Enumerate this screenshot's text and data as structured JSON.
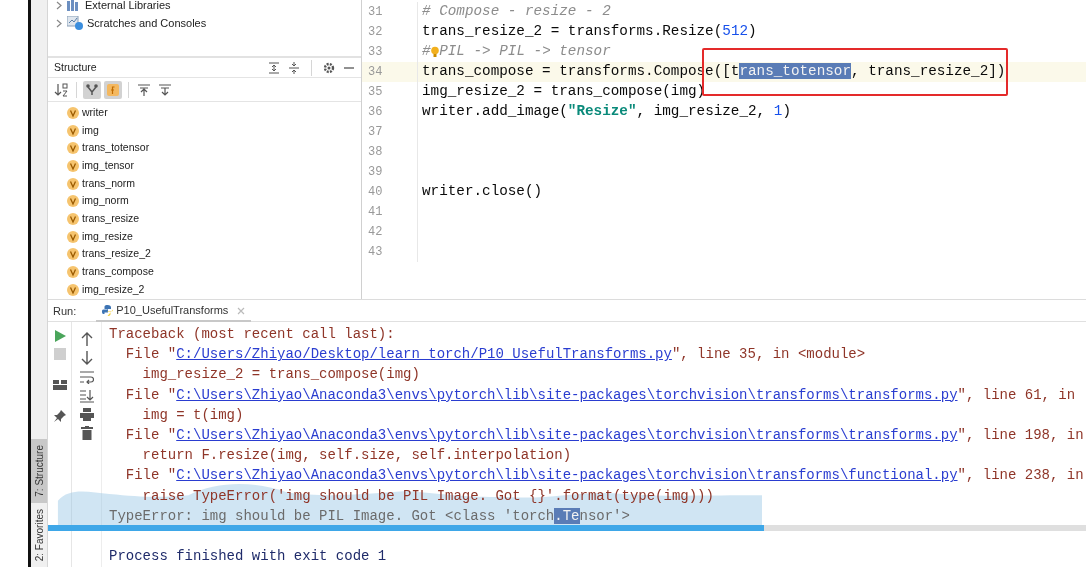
{
  "project_tree": [
    {
      "label": "External Libraries",
      "kind": "libraries"
    },
    {
      "label": "Scratches and Consoles",
      "kind": "scratches"
    }
  ],
  "structure": {
    "title": "Structure",
    "toolbar": [
      {
        "kind": "sort",
        "selected": false
      },
      {
        "kind": "inherited",
        "selected": true
      },
      {
        "kind": "fields",
        "selected": true
      },
      {
        "kind": "up",
        "selected": false
      },
      {
        "kind": "down",
        "selected": false
      }
    ],
    "items": [
      {
        "name": "writer"
      },
      {
        "name": "img"
      },
      {
        "name": "trans_totensor"
      },
      {
        "name": "img_tensor"
      },
      {
        "name": "trans_norm"
      },
      {
        "name": "img_norm"
      },
      {
        "name": "trans_resize"
      },
      {
        "name": "img_resize"
      },
      {
        "name": "trans_resize_2"
      },
      {
        "name": "trans_compose"
      },
      {
        "name": "img_resize_2"
      }
    ]
  },
  "editor": {
    "lines": [
      {
        "number": "31",
        "current": false,
        "segments": [
          {
            "text": "# Compose - resize - 2",
            "kind": "comment"
          }
        ]
      },
      {
        "number": "32",
        "current": false,
        "segments": [
          {
            "text": "trans_resize_2 = transforms.Resize(",
            "kind": "plain"
          },
          {
            "text": "512",
            "kind": "number"
          },
          {
            "text": ")",
            "kind": "plain"
          }
        ]
      },
      {
        "number": "33",
        "current": false,
        "segments": [
          {
            "text": "#",
            "kind": "comment"
          },
          {
            "kind": "bulb"
          },
          {
            "text": "PIL -> PIL -> tensor",
            "kind": "comment"
          }
        ]
      },
      {
        "number": "34",
        "current": true,
        "segments": [
          {
            "text": "trans_compose = transforms.Compose([t",
            "kind": "plain"
          },
          {
            "text": "rans_totensor",
            "kind": "selected"
          },
          {
            "text": ", trans_resize_2])",
            "kind": "plain"
          }
        ]
      },
      {
        "number": "35",
        "current": false,
        "segments": [
          {
            "text": "img_resize_2 = trans_compose(img)",
            "kind": "plain"
          }
        ]
      },
      {
        "number": "36",
        "current": false,
        "segments": [
          {
            "text": "writer.add_image(",
            "kind": "plain"
          },
          {
            "text": "\"Resize\"",
            "kind": "string"
          },
          {
            "text": ", img_resize_2, ",
            "kind": "plain"
          },
          {
            "text": "1",
            "kind": "number"
          },
          {
            "text": ")",
            "kind": "plain"
          }
        ]
      },
      {
        "number": "37",
        "current": false
      },
      {
        "number": "38",
        "current": false
      },
      {
        "number": "39",
        "current": false
      },
      {
        "number": "40",
        "current": false,
        "segments": [
          {
            "text": "writer.close()",
            "kind": "plain"
          }
        ]
      },
      {
        "number": "41",
        "current": false
      },
      {
        "number": "42",
        "current": false
      },
      {
        "number": "43",
        "current": false
      }
    ]
  },
  "run": {
    "label": "Run:",
    "tab": "P10_UsefulTransforms",
    "console": [
      {
        "segments": [
          {
            "text": "Traceback (most recent call last):",
            "kind": "err"
          }
        ]
      },
      {
        "segments": [
          {
            "text": "  File \"",
            "kind": "err"
          },
          {
            "text": "C:/Users/Zhiyao/Desktop/learn_torch/P10_UsefulTransforms.py",
            "kind": "link"
          },
          {
            "text": "\", line 35, in <module>",
            "kind": "err"
          }
        ]
      },
      {
        "segments": [
          {
            "text": "    img_resize_2 = trans_compose(img)",
            "kind": "err"
          }
        ]
      },
      {
        "segments": [
          {
            "text": "  File \"",
            "kind": "err"
          },
          {
            "text": "C:\\Users\\Zhiyao\\Anaconda3\\envs\\pytorch\\lib\\site-packages\\torchvision\\transforms\\transforms.py",
            "kind": "link"
          },
          {
            "text": "\", line 61, in",
            "kind": "err"
          }
        ]
      },
      {
        "segments": [
          {
            "text": "    img = t(img)",
            "kind": "err"
          }
        ]
      },
      {
        "segments": [
          {
            "text": "  File \"",
            "kind": "err"
          },
          {
            "text": "C:\\Users\\Zhiyao\\Anaconda3\\envs\\pytorch\\lib\\site-packages\\torchvision\\transforms\\transforms.py",
            "kind": "link"
          },
          {
            "text": "\", line 198, in",
            "kind": "err"
          }
        ]
      },
      {
        "segments": [
          {
            "text": "    return F.resize(img, self.size, self.interpolation)",
            "kind": "err"
          }
        ]
      },
      {
        "segments": [
          {
            "text": "  File \"",
            "kind": "err"
          },
          {
            "text": "C:\\Users\\Zhiyao\\Anaconda3\\envs\\pytorch\\lib\\site-packages\\torchvision\\transforms\\functional.py",
            "kind": "link"
          },
          {
            "text": "\", line 238, in",
            "kind": "err"
          }
        ]
      },
      {
        "segments": [
          {
            "text": "    raise TypeError('img should be PIL Image. Got {}'.format(type(img)))",
            "kind": "err"
          }
        ]
      },
      {
        "segments": [
          {
            "text": "TypeError: img should be PIL Image. Got <class 'torch",
            "kind": "muted"
          },
          {
            "text": ".Te",
            "kind": "selected"
          },
          {
            "text": "nsor'>",
            "kind": "muted"
          }
        ]
      },
      {
        "blank_before": true,
        "segments": [
          {
            "text": "Process finished with exit code 1",
            "kind": "sys"
          }
        ]
      }
    ]
  },
  "side_tabs": [
    {
      "label": "7: Structure",
      "selected": true
    },
    {
      "label": "2: Favorites",
      "selected": false
    }
  ],
  "video": {
    "level": 0.69
  }
}
